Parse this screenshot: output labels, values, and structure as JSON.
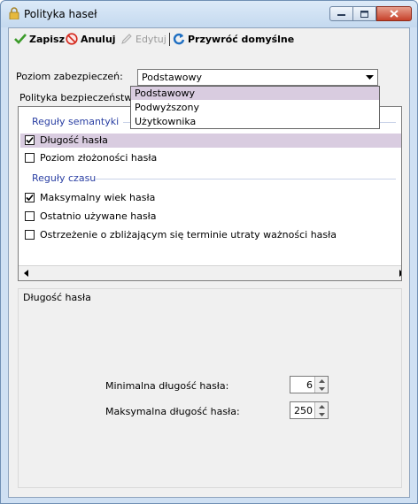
{
  "window": {
    "title": "Polityka haseł"
  },
  "toolbar": {
    "save_label": "Zapisz",
    "cancel_label": "Anuluj",
    "edit_label": "Edytuj",
    "restore_label": "Przywróć domyślne"
  },
  "security_level": {
    "label": "Poziom zabezpieczeń:",
    "selected": "Podstawowy",
    "options": [
      "Podstawowy",
      "Podwyższony",
      "Użytkownika"
    ]
  },
  "policy_tab": {
    "label": "Polityka bezpieczeństwa"
  },
  "rules": {
    "semantic_group": "Reguły semantyki",
    "semantic_items": [
      {
        "label": "Długość hasła",
        "checked": true
      },
      {
        "label": "Poziom złożoności hasła",
        "checked": false
      }
    ],
    "time_group": "Reguły czasu",
    "time_items": [
      {
        "label": "Maksymalny wiek hasła",
        "checked": true
      },
      {
        "label": "Ostatnio używane hasła",
        "checked": false
      },
      {
        "label": "Ostrzeżenie o zbliżającym się terminie utraty ważności hasła",
        "checked": false
      }
    ]
  },
  "details": {
    "section_title": "Długość hasła",
    "min_label": "Minimalna długość hasła:",
    "min_value": "6",
    "max_label": "Maksymalna długość hasła:",
    "max_value": "250"
  },
  "colors": {
    "selection": "#d9cce0",
    "group_title": "#2a3fa3",
    "titlebar": "#c4d9ef"
  }
}
